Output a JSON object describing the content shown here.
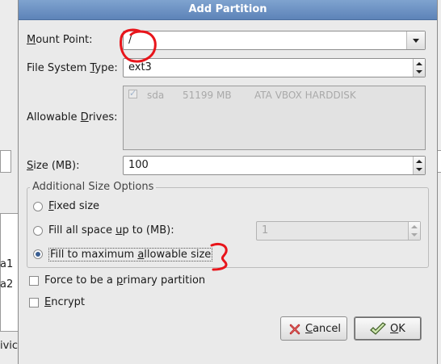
{
  "dialog": {
    "title": "Add Partition",
    "mount_point": {
      "label": "Mount Point:",
      "label_u": "M",
      "label_rest": "ount Point:",
      "value": "/"
    },
    "fs_type": {
      "label_pre": "File System ",
      "label_u": "T",
      "label_rest": "ype:",
      "value": "ext3"
    },
    "drives": {
      "label_pre": "Allowable ",
      "label_u": "D",
      "label_rest": "rives:",
      "rows": [
        {
          "name": "sda",
          "size": "51199 MB",
          "model": "ATA VBOX HARDDISK",
          "checked": true
        }
      ]
    },
    "size": {
      "label_u": "S",
      "label_rest": "ize (MB):",
      "value": "100"
    },
    "size_options": {
      "title": "Additional Size Options",
      "fixed": {
        "u": "F",
        "rest": "ixed size",
        "selected": false
      },
      "fill_upto": {
        "pre": "Fill all space ",
        "u": "u",
        "rest": "p to (MB):",
        "value": "1",
        "selected": false
      },
      "fill_max": {
        "pre": "Fill to maximum ",
        "u": "a",
        "rest": "llowable size",
        "selected": true
      }
    },
    "force_primary": {
      "pre": "Force to be a ",
      "u": "p",
      "rest": "rimary partition",
      "checked": false
    },
    "encrypt": {
      "u": "E",
      "rest": "ncrypt",
      "checked": false
    },
    "buttons": {
      "cancel": {
        "u": "C",
        "rest": "ancel"
      },
      "ok": {
        "u": "O",
        "rest": "K"
      }
    }
  },
  "background": {
    "left_text": [
      "a1",
      "a2",
      "ivic"
    ]
  },
  "colors": {
    "titlebar": "#6b8fc4",
    "annotation": "#e8151b"
  },
  "icons": {
    "cancel": "cancel-icon",
    "ok": "ok-check-icon",
    "combo": "chevron-down-icon"
  }
}
